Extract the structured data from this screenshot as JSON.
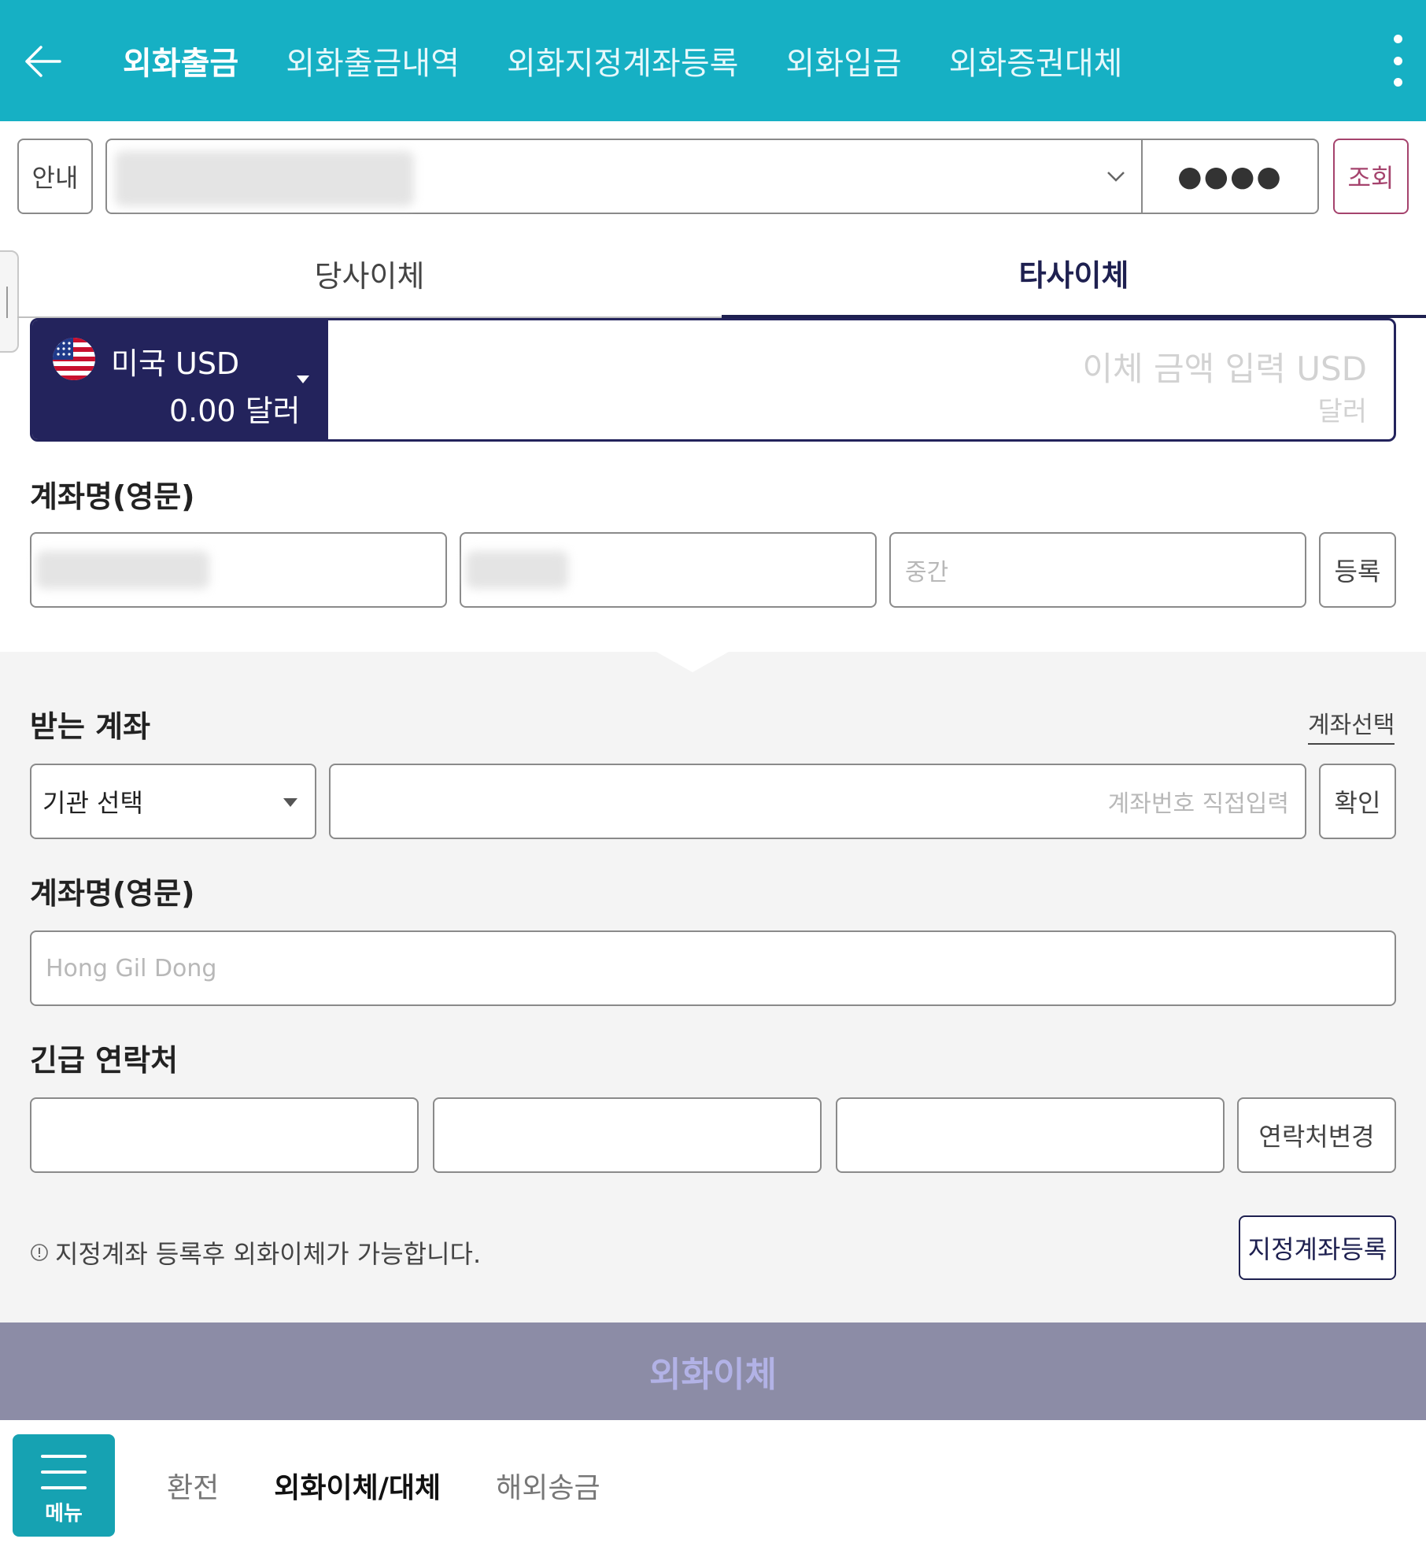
{
  "header": {
    "tabs": [
      {
        "label": "외화출금",
        "active": true
      },
      {
        "label": "외화출금내역",
        "active": false
      },
      {
        "label": "외화지정계좌등록",
        "active": false
      },
      {
        "label": "외화입금",
        "active": false
      },
      {
        "label": "외화증권대체",
        "active": false
      }
    ]
  },
  "account_row": {
    "info_label": "안내",
    "password_mask": "●●●●",
    "query_label": "조회"
  },
  "transfer_tabs": [
    {
      "label": "당사이체",
      "active": false
    },
    {
      "label": "타사이체",
      "active": true
    }
  ],
  "amount": {
    "currency_name": "미국 USD",
    "balance": "0.00 달러",
    "placeholder_main": "이체 금액 입력 USD",
    "placeholder_unit": "달러"
  },
  "sender": {
    "label": "계좌명(영문)",
    "middle_placeholder": "중간",
    "register_label": "등록"
  },
  "receiver": {
    "label": "받는 계좌",
    "select_account_link": "계좌선택",
    "institution_select": "기관 선택",
    "account_number_placeholder": "계좌번호 직접입력",
    "confirm_label": "확인",
    "name_label": "계좌명(영문)",
    "name_placeholder": "Hong Gil Dong"
  },
  "contact": {
    "label": "긴급 연락처",
    "change_label": "연락처변경"
  },
  "notice": {
    "text": "지정계좌 등록후 외화이체가 가능합니다.",
    "register_button": "지정계좌등록"
  },
  "submit_label": "외화이체",
  "bottom_bar": {
    "menu_label": "메뉴",
    "tabs": [
      {
        "label": "환전",
        "active": false
      },
      {
        "label": "외화이체/대체",
        "active": true
      },
      {
        "label": "해외송금",
        "active": false
      }
    ]
  },
  "colors": {
    "header_bg": "#16b0c4",
    "navy": "#23235c",
    "query_accent": "#a5436d",
    "submit_bg": "#8c8ca6",
    "menu_bg": "#16a2b2"
  }
}
